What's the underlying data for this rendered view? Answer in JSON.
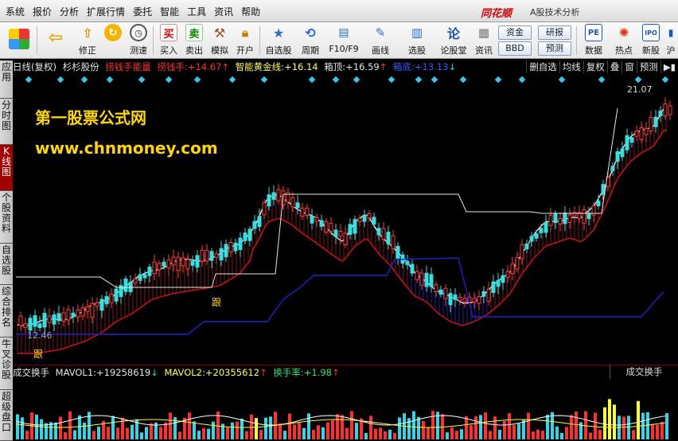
{
  "menu": {
    "items": [
      "系统",
      "报价",
      "分析",
      "扩展行情",
      "委托",
      "智能",
      "工具",
      "资讯",
      "帮助"
    ],
    "brand": "同花顺",
    "app_title": "A股技术分析"
  },
  "toolbar": {
    "buttons": [
      {
        "label": "",
        "icon": "home-icon"
      },
      {
        "label": "",
        "icon": "back-arrow-icon"
      },
      {
        "label": "修正",
        "icon": "arrow-up-icon"
      },
      {
        "label": "测速",
        "icon": "clock-icon"
      },
      {
        "label": "买入",
        "icon": "buy-icon",
        "glyph": "买"
      },
      {
        "label": "卖出",
        "icon": "sell-icon",
        "glyph": "卖"
      },
      {
        "label": "模拟",
        "icon": "hammer-icon"
      },
      {
        "label": "开户",
        "icon": "lock-icon"
      },
      {
        "label": "自选股",
        "icon": "star-icon"
      },
      {
        "label": "周期",
        "icon": "cycle-icon"
      },
      {
        "label": "F10/F9",
        "icon": "f10-icon"
      },
      {
        "label": "画线",
        "icon": "pen-icon"
      },
      {
        "label": "选股",
        "icon": "chart-icon"
      },
      {
        "label": "论股堂",
        "icon": "lun-icon",
        "glyph": "论"
      },
      {
        "label": "资讯",
        "icon": "doc-icon"
      },
      {
        "label": "数据",
        "icon": "pe-icon",
        "glyph": "PE"
      },
      {
        "label": "热点",
        "icon": "hot-icon"
      },
      {
        "label": "新股",
        "icon": "ipo-icon",
        "glyph": "IPO"
      },
      {
        "label": "沪",
        "icon": "sh-icon"
      }
    ],
    "small_buttons": [
      "资金",
      "研报",
      "BBD",
      "预测"
    ]
  },
  "left_tabs": [
    "应用",
    "分时图",
    "K线图",
    "个股资料",
    "自选股",
    "综合排名",
    "牛叉诊股",
    "超级盘口"
  ],
  "info_line": {
    "period": "日线(复权)",
    "stock": "杉杉股份",
    "ind1": "捞钱手能量",
    "ind2_label": "捞钱手:",
    "ind2_value": "+14.67",
    "ind2_arrow": "↑",
    "ind3_label": "智能黄金线:",
    "ind3_value": "+16.14",
    "ind4_label": "箱顶:",
    "ind4_value": "+16.59",
    "ind4_arrow": "↑",
    "ind5_label": "箱底:",
    "ind5_value": "+13.13",
    "ind5_arrow": "↓"
  },
  "right_buttons": [
    "删自选",
    "均线",
    "复权",
    "叠",
    "窗",
    "预测"
  ],
  "watermark": {
    "line1": "第一股票公式网",
    "line2": "www.chnmoney.com"
  },
  "price_high": "21.07",
  "price_low": "12.46",
  "signals": [
    "跟",
    "跟"
  ],
  "volume_header": {
    "title": "成交换手",
    "mavol1_label": "MAVOL1:",
    "mavol1_value": "+19258619",
    "mavol1_arrow": "↓",
    "mavol2_label": "MAVOL2:",
    "mavol2_value": "+20355612",
    "mavol2_arrow": "↑",
    "turnover_label": "换手率:",
    "turnover_value": "+1.98",
    "turnover_arrow": "↑",
    "selector": "成交换手"
  },
  "colors": {
    "up": "#ff3b3b",
    "down": "#35e0e0",
    "gold_line": "#ffffff",
    "box_top": "#e6e6e6",
    "box_bottom": "#2020d0",
    "channel_red": "#d01010",
    "channel_blue": "#1f2aa8",
    "volume_up": "#ff3030",
    "volume_down": "#33d6e6",
    "volume_yellow": "#ffff30"
  }
}
